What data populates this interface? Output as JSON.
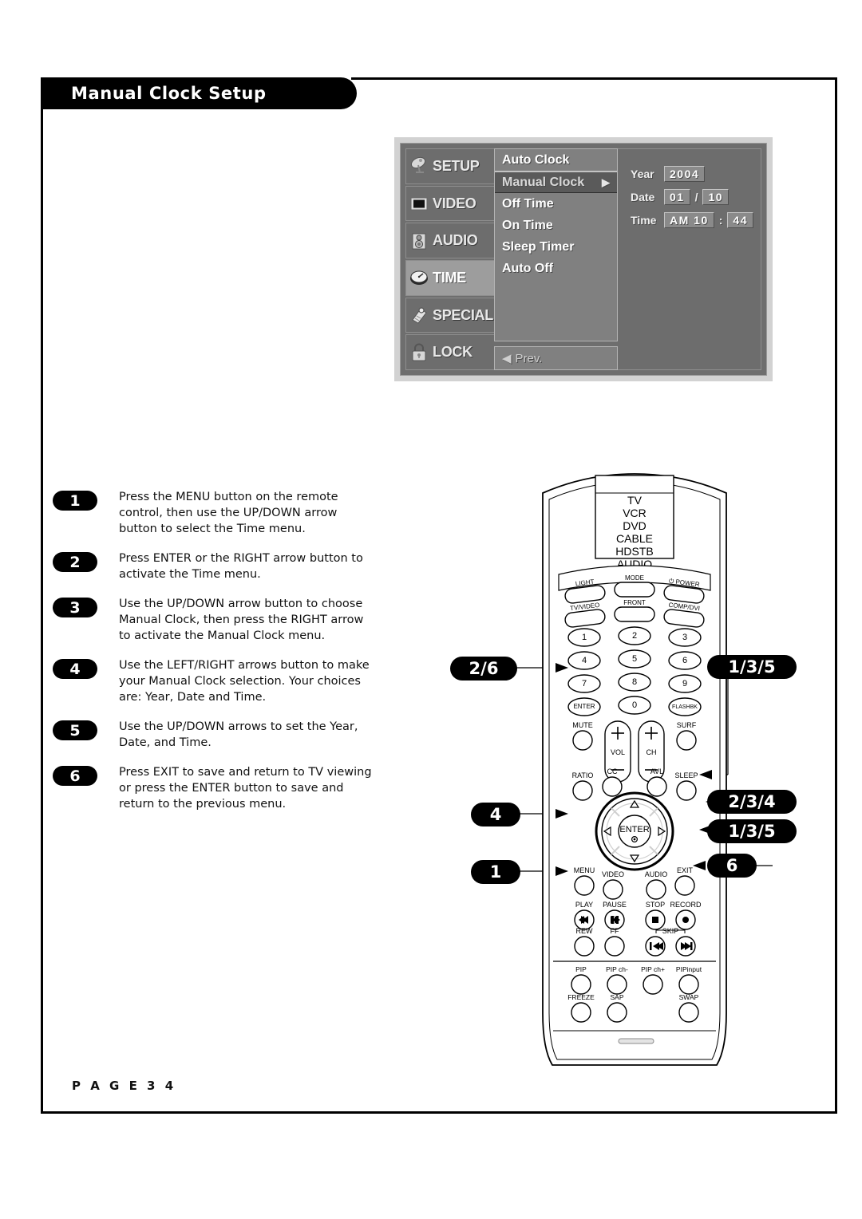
{
  "page": {
    "title": "Manual Clock Setup",
    "footer": "P A G E   3 4"
  },
  "osd": {
    "categories": [
      {
        "label": "SETUP",
        "icon": "satellite-dish-icon",
        "selected": false
      },
      {
        "label": "VIDEO",
        "icon": "screen-icon",
        "selected": false
      },
      {
        "label": "AUDIO",
        "icon": "speaker-icon",
        "selected": false
      },
      {
        "label": "TIME",
        "icon": "clock-icon",
        "selected": true
      },
      {
        "label": "SPECIAL",
        "icon": "tag-icon",
        "selected": false
      },
      {
        "label": "LOCK",
        "icon": "padlock-icon",
        "selected": false
      }
    ],
    "menu_items": [
      {
        "label": "Auto Clock",
        "highlight": false,
        "arrow": ""
      },
      {
        "label": "Manual Clock",
        "highlight": true,
        "arrow": "▶"
      },
      {
        "label": "Off Time",
        "highlight": false,
        "arrow": ""
      },
      {
        "label": "On Time",
        "highlight": false,
        "arrow": ""
      },
      {
        "label": "Sleep Timer",
        "highlight": false,
        "arrow": ""
      },
      {
        "label": "Auto Off",
        "highlight": false,
        "arrow": ""
      }
    ],
    "prev": {
      "arrow": "◀",
      "label": "Prev."
    },
    "values": {
      "year_label": "Year",
      "year_value": "2004",
      "date_label": "Date",
      "date_month": "01",
      "date_separator": "/",
      "date_day": "10",
      "time_label": "Time",
      "time_hour": "AM 10",
      "time_separator": ":",
      "time_minute": "44"
    }
  },
  "steps": [
    {
      "number": "1",
      "text": "Press the MENU button on the remote control, then use the UP/DOWN arrow button to select the Time menu."
    },
    {
      "number": "2",
      "text": "Press ENTER or the RIGHT arrow button to activate the Time menu."
    },
    {
      "number": "3",
      "text": "Use the UP/DOWN arrow button to choose Manual Clock, then press the RIGHT arrow to activate the Manual Clock menu."
    },
    {
      "number": "4",
      "text": "Use the LEFT/RIGHT arrows button to make your Manual Clock selection. Your choices are: Year, Date and Time."
    },
    {
      "number": "5",
      "text": "Use the UP/DOWN arrows to set the Year, Date, and Time."
    },
    {
      "number": "6",
      "text": "Press EXIT to save and return to TV viewing or press the ENTER button to save and return to the previous menu."
    }
  ],
  "remote": {
    "devices": [
      "TV",
      "VCR",
      "DVD",
      "CABLE",
      "HDSTB",
      "AUDIO"
    ],
    "top_buttons": [
      "LIGHT",
      "MODE",
      "POWER",
      "TV/VIDEO",
      "FRONT",
      "COMP/DVI"
    ],
    "keypad": [
      "1",
      "2",
      "3",
      "4",
      "5",
      "6",
      "7",
      "8",
      "9",
      "ENTER",
      "0",
      "FLASHBK"
    ],
    "volume_row": [
      "MUTE",
      "VOL",
      "CH",
      "SURF"
    ],
    "feature_row": [
      "RATIO",
      "CC",
      "AVL",
      "SLEEP"
    ],
    "nav_center": "ENTER",
    "nav_row": [
      "MENU",
      "VIDEO",
      "AUDIO",
      "EXIT"
    ],
    "transport_row1": [
      "PLAY",
      "PAUSE",
      "STOP",
      "RECORD"
    ],
    "transport_row2": [
      "REW",
      "FF",
      "SKIP"
    ],
    "pip_row1": [
      "PIP",
      "PIP ch-",
      "PIP ch+",
      "PIPinput"
    ],
    "pip_row2": [
      "FREEZE",
      "SAP",
      "SWAP"
    ]
  },
  "callouts": {
    "left": [
      {
        "label": "2/6",
        "target": "enter-key"
      },
      {
        "label": "4",
        "target": "left-arrow"
      },
      {
        "label": "1",
        "target": "menu-button"
      }
    ],
    "right": [
      {
        "label": "1/3/5",
        "target": "up-arrow"
      },
      {
        "label": "2/3/4",
        "target": "right-arrow"
      },
      {
        "label": "1/3/5",
        "target": "down-arrow"
      },
      {
        "label": "6",
        "target": "exit-button"
      }
    ]
  }
}
